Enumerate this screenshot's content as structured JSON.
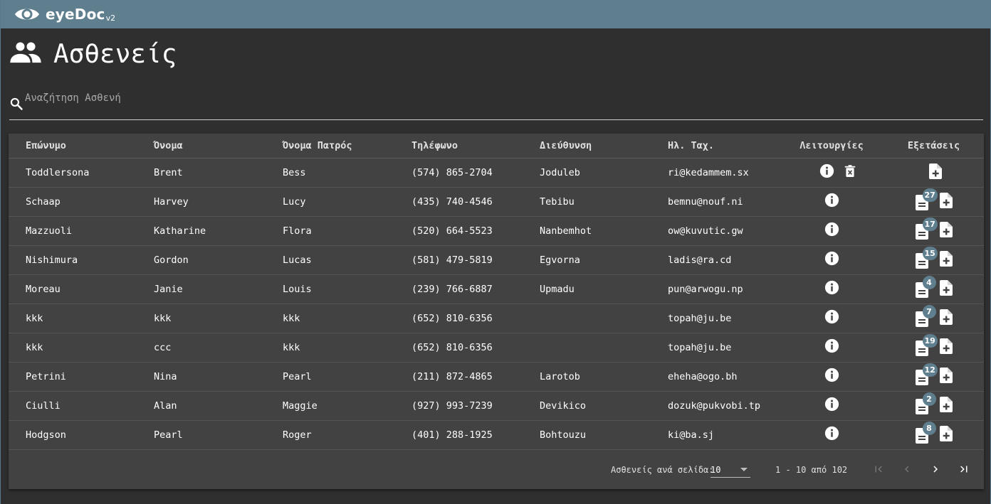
{
  "app": {
    "name": "eyeDoc",
    "version": "v2"
  },
  "page": {
    "title": "Ασθενείς"
  },
  "search": {
    "placeholder": "Αναζήτηση Ασθενή"
  },
  "table": {
    "headers": {
      "surname": "Επώνυμο",
      "name": "Όνομα",
      "father": "Όνομα Πατρός",
      "phone": "Τηλέφωνο",
      "address": "Διεύθυνση",
      "email": "Ηλ. Ταχ.",
      "actions": "Λειτουργίες",
      "exams": "Εξετάσεις"
    },
    "rows": [
      {
        "surname": "Toddlersona",
        "name": "Brent",
        "father": "Bess",
        "phone": "(574) 865-2704",
        "address": "Joduleb",
        "email": "ri@kedammem.sx",
        "exams": ""
      },
      {
        "surname": "Schaap",
        "name": "Harvey",
        "father": "Lucy",
        "phone": "(435) 740-4546",
        "address": "Tebibu",
        "email": "bemnu@nouf.ni",
        "exams": "27"
      },
      {
        "surname": "Mazzuoli",
        "name": "Katharine",
        "father": "Flora",
        "phone": "(520) 664-5523",
        "address": "Nanbemhot",
        "email": "ow@kuvutic.gw",
        "exams": "17"
      },
      {
        "surname": "Nishimura",
        "name": "Gordon",
        "father": "Lucas",
        "phone": "(581) 479-5819",
        "address": "Egvorna",
        "email": "ladis@ra.cd",
        "exams": "15"
      },
      {
        "surname": "Moreau",
        "name": "Janie",
        "father": "Louis",
        "phone": "(239) 766-6887",
        "address": "Upmadu",
        "email": "pun@arwogu.np",
        "exams": "4"
      },
      {
        "surname": "kkk",
        "name": "kkk",
        "father": "kkk",
        "phone": "(652) 810-6356",
        "address": "",
        "email": "topah@ju.be",
        "exams": "7"
      },
      {
        "surname": "kkk",
        "name": "ccc",
        "father": "kkk",
        "phone": "(652) 810-6356",
        "address": "",
        "email": "topah@ju.be",
        "exams": "19"
      },
      {
        "surname": "Petrini",
        "name": "Nina",
        "father": "Pearl",
        "phone": "(211) 872-4865",
        "address": "Larotob",
        "email": "eheha@ogo.bh",
        "exams": "12"
      },
      {
        "surname": "Ciulli",
        "name": "Alan",
        "father": "Maggie",
        "phone": "(927) 993-7239",
        "address": "Devikico",
        "email": "dozuk@pukvobi.tp",
        "exams": "2"
      },
      {
        "surname": "Hodgson",
        "name": "Pearl",
        "father": "Roger",
        "phone": "(401) 288-1925",
        "address": "Bohtouzu",
        "email": "ki@ba.sj",
        "exams": "8"
      }
    ]
  },
  "paginator": {
    "per_page_label": "Ασθενείς ανά σελίδα:",
    "per_page_value": "10",
    "range": "1 - 10 από 102"
  },
  "colors": {
    "topbar": "#5f7f8f",
    "background": "#2f2f2f",
    "card": "#424242",
    "badge": "#5f7f8f"
  }
}
